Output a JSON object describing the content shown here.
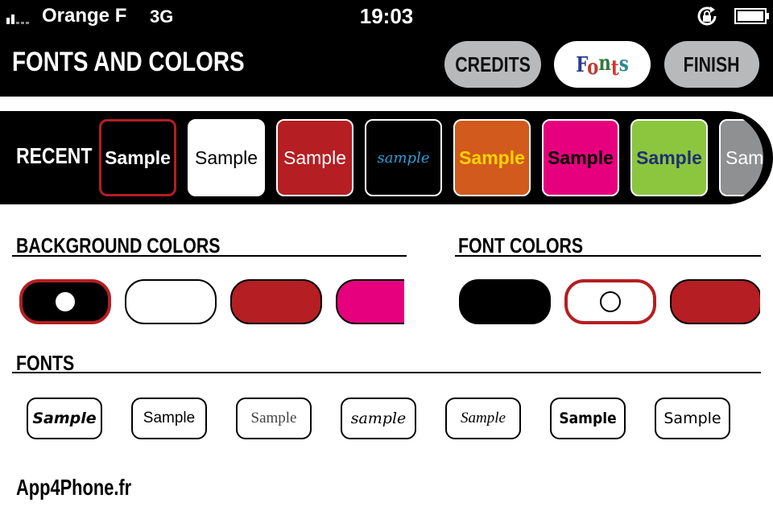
{
  "status_bar": {
    "carrier": "Orange F",
    "network": "3G",
    "time": "19:03",
    "icons": [
      "signal-bars-icon",
      "rotation-lock-icon",
      "battery-icon"
    ]
  },
  "header": {
    "title": "FONTS AND COLORS",
    "buttons": {
      "credits": "CREDITS",
      "fonts": "Fonts",
      "finish": "FINISH"
    },
    "fonts_letter_colors": [
      "#2b3a8c",
      "#c0392b",
      "#2f7a3a",
      "#d9342b",
      "#2b8a8c"
    ]
  },
  "recent": {
    "label": "RECENT",
    "tiles": [
      {
        "text": "Sample",
        "bg": "#000000",
        "fg": "#ffffff",
        "font": "sans-bold",
        "selected": true
      },
      {
        "text": "Sample",
        "bg": "#ffffff",
        "fg": "#000000",
        "font": "sans"
      },
      {
        "text": "Sample",
        "bg": "#b51e22",
        "fg": "#ffffff",
        "font": "sans"
      },
      {
        "text": "sample",
        "bg": "#000000",
        "fg": "#2a9fd8",
        "font": "script"
      },
      {
        "text": "Sample",
        "bg": "#d25a1c",
        "fg": "#ffd400",
        "font": "sans-bold"
      },
      {
        "text": "Sample",
        "bg": "#e6007e",
        "fg": "#000000",
        "font": "sans-bold"
      },
      {
        "text": "Sample",
        "bg": "#8cc63f",
        "fg": "#1f2f73",
        "font": "sans-bold"
      },
      {
        "text": "Sample",
        "bg": "#8e9092",
        "fg": "#ffffff",
        "font": "sans"
      }
    ]
  },
  "background_colors": {
    "title": "BACKGROUND COLORS",
    "swatches": [
      {
        "color": "#000000",
        "selected": true
      },
      {
        "color": "#ffffff"
      },
      {
        "color": "#b51e22"
      },
      {
        "color": "#e6007e"
      }
    ]
  },
  "font_colors": {
    "title": "FONT COLORS",
    "swatches": [
      {
        "color": "#000000"
      },
      {
        "color": "#ffffff",
        "selected": true
      },
      {
        "color": "#b51e22"
      }
    ]
  },
  "fonts": {
    "title": "FONTS",
    "tiles": [
      {
        "text": "Sample",
        "style": "marker"
      },
      {
        "text": "Sample",
        "style": "sans"
      },
      {
        "text": "Sample",
        "style": "serif"
      },
      {
        "text": "sample",
        "style": "script"
      },
      {
        "text": "Sample",
        "style": "serif-italic"
      },
      {
        "text": "Sample",
        "style": "condensed-bold"
      },
      {
        "text": "Sample",
        "style": "sans-light"
      }
    ]
  },
  "footer": {
    "text": "App4Phone.fr"
  }
}
